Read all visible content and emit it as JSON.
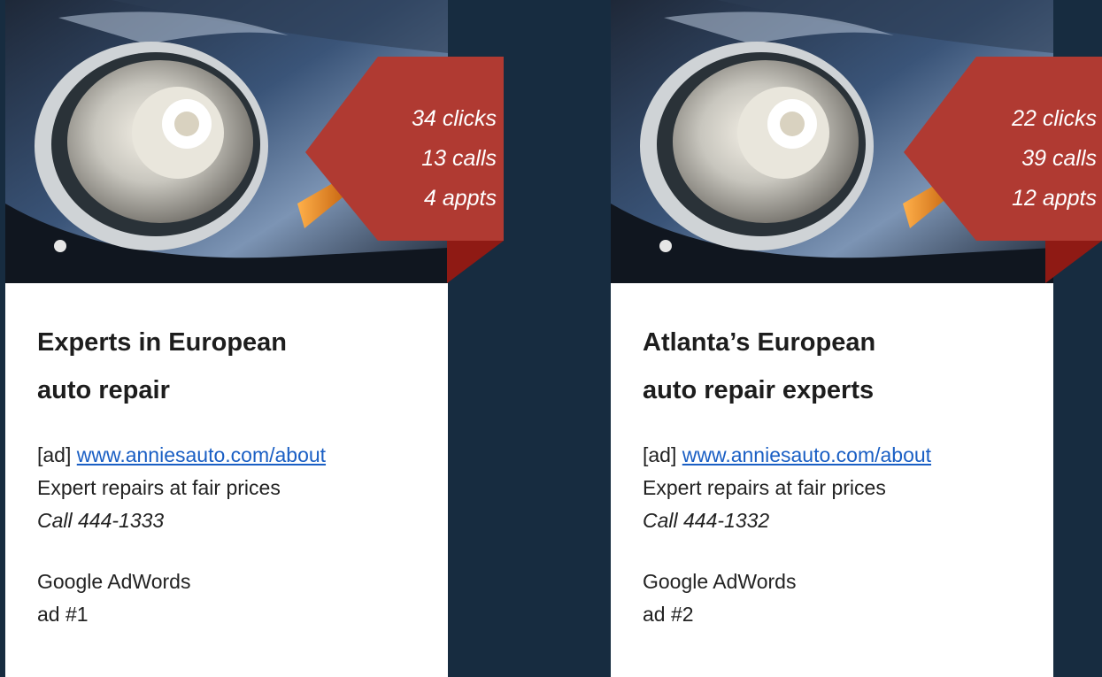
{
  "colors": {
    "background": "#172c40",
    "card": "#ffffff",
    "flag": "#b03a32",
    "flag_fold": "#8f1a14",
    "link": "#1a5fc4"
  },
  "ads": [
    {
      "stats": [
        "34 clicks",
        "13 calls",
        "4 appts"
      ],
      "headline": "Experts in European auto repair",
      "prefix": "[ad]",
      "url": "www.anniesauto.com/about",
      "description": "Expert repairs at fair prices",
      "call": "Call 444-1333",
      "footer_line1": "Google AdWords",
      "footer_line2": "ad #1"
    },
    {
      "stats": [
        "22 clicks",
        "39 calls",
        "12 appts"
      ],
      "headline": "Atlanta’s European auto repair experts",
      "prefix": "[ad]",
      "url": "www.anniesauto.com/about",
      "description": "Expert repairs at fair prices",
      "call": "Call 444-1332",
      "footer_line1": "Google AdWords",
      "footer_line2": "ad #2"
    }
  ]
}
